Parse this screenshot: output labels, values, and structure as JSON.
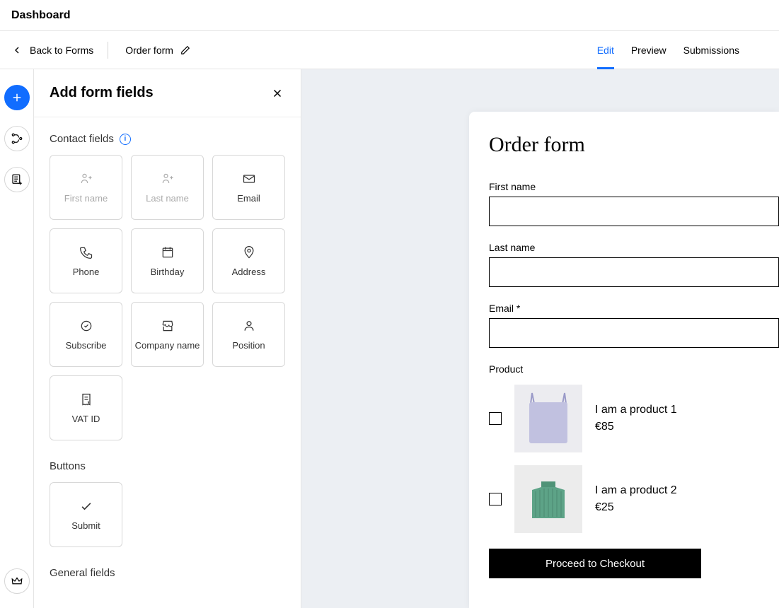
{
  "topbar": {
    "title": "Dashboard"
  },
  "subbar": {
    "back_label": "Back to Forms",
    "form_name": "Order form",
    "tabs": [
      "Edit",
      "Preview",
      "Submissions"
    ],
    "active_tab": 0
  },
  "panel": {
    "title": "Add form fields",
    "sections": {
      "contact": {
        "title": "Contact fields",
        "fields": [
          {
            "label": "First name",
            "icon": "person",
            "disabled": true
          },
          {
            "label": "Last name",
            "icon": "person",
            "disabled": true
          },
          {
            "label": "Email",
            "icon": "mail",
            "disabled": false
          },
          {
            "label": "Phone",
            "icon": "phone",
            "disabled": false
          },
          {
            "label": "Birthday",
            "icon": "calendar",
            "disabled": false
          },
          {
            "label": "Address",
            "icon": "location",
            "disabled": false
          },
          {
            "label": "Subscribe",
            "icon": "check-circle",
            "disabled": false
          },
          {
            "label": "Company name",
            "icon": "store",
            "disabled": false
          },
          {
            "label": "Position",
            "icon": "user",
            "disabled": false
          },
          {
            "label": "VAT ID",
            "icon": "receipt",
            "disabled": false
          }
        ]
      },
      "buttons": {
        "title": "Buttons",
        "fields": [
          {
            "label": "Submit",
            "icon": "check",
            "disabled": false
          }
        ]
      },
      "general": {
        "title": "General fields"
      }
    }
  },
  "form": {
    "title": "Order form",
    "fields": {
      "first_name": {
        "label": "First name"
      },
      "last_name": {
        "label": "Last name"
      },
      "email": {
        "label": "Email *"
      },
      "product": {
        "label": "Product"
      }
    },
    "products": [
      {
        "name": "I am a product 1",
        "price": "€85",
        "img": "bag"
      },
      {
        "name": "I am a product 2",
        "price": "€25",
        "img": "sweater"
      }
    ],
    "checkout_label": "Proceed to Checkout"
  }
}
